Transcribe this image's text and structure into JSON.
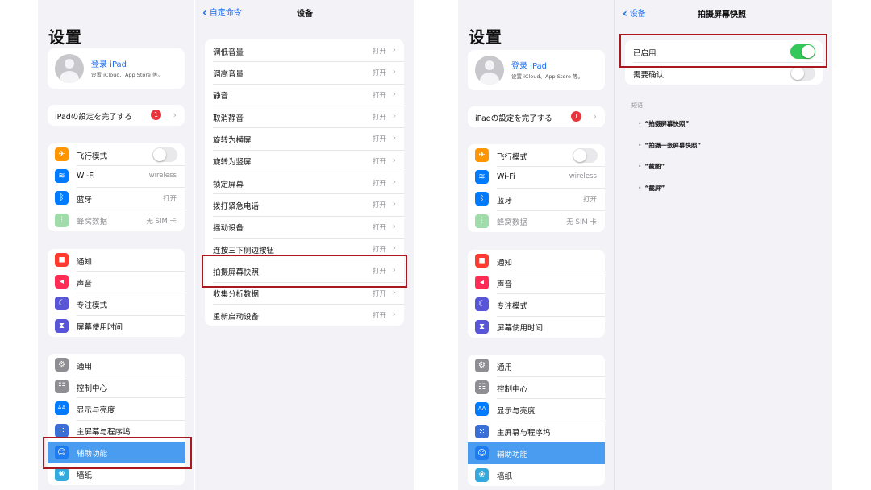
{
  "colors": {
    "accent": "#1b6ff2",
    "highlight": "#a9181f",
    "toggle_on": "#34c759",
    "selected_row": "#4a9cf0"
  },
  "left_screen": {
    "sidebar": {
      "title": "设置",
      "profile": {
        "name": "登录 iPad",
        "subtitle": "设置 iCloud、App Store 等。"
      },
      "setup": {
        "label": "iPadの設定を完了する",
        "badge": "1"
      },
      "group1": [
        {
          "label": "飞行模式",
          "icon": "airplane-icon",
          "color": "#ff9500",
          "glyph": "✈",
          "toggle": false
        },
        {
          "label": "Wi-Fi",
          "icon": "wifi-icon",
          "color": "#007aff",
          "glyph": "≋",
          "value": "wireless"
        },
        {
          "label": "蓝牙",
          "icon": "bluetooth-icon",
          "color": "#007aff",
          "glyph": "ᛒ",
          "value": "打开"
        },
        {
          "label": "蜂窝数据",
          "icon": "cellular-icon",
          "color": "#9fdca9",
          "glyph": "⫶",
          "value": "无 SIM 卡",
          "dim": true
        }
      ],
      "group2": [
        {
          "label": "通知",
          "icon": "notification-icon",
          "color": "#ff3b30",
          "glyph": "◼"
        },
        {
          "label": "声音",
          "icon": "sound-icon",
          "color": "#ff2d55",
          "glyph": "◂"
        },
        {
          "label": "专注模式",
          "icon": "moon-icon",
          "color": "#5856d6",
          "glyph": "☾"
        },
        {
          "label": "屏幕使用时间",
          "icon": "hourglass-icon",
          "color": "#5856d6",
          "glyph": "⧗"
        }
      ],
      "group3": [
        {
          "label": "通用",
          "icon": "gear-icon",
          "color": "#8e8e93",
          "glyph": "⚙"
        },
        {
          "label": "控制中心",
          "icon": "control-center-icon",
          "color": "#8e8e93",
          "glyph": "☷"
        },
        {
          "label": "显示与亮度",
          "icon": "display-icon",
          "color": "#007aff",
          "glyph": "AA"
        },
        {
          "label": "主屏幕与程序坞",
          "icon": "home-screen-icon",
          "color": "#3a6fd8",
          "glyph": "⁙"
        },
        {
          "label": "辅助功能",
          "icon": "accessibility-icon",
          "color": "#1e7cf0",
          "glyph": "☺",
          "selected": true
        },
        {
          "label": "墙纸",
          "icon": "wallpaper-icon",
          "color": "#34aadc",
          "glyph": "❀"
        }
      ]
    },
    "detail": {
      "back_label": "自定命令",
      "title": "设备",
      "items": [
        {
          "label": "调低音量",
          "value": "打开"
        },
        {
          "label": "调高音量",
          "value": "打开"
        },
        {
          "label": "静音",
          "value": "打开"
        },
        {
          "label": "取消静音",
          "value": "打开"
        },
        {
          "label": "旋转为横屏",
          "value": "打开"
        },
        {
          "label": "旋转为竖屏",
          "value": "打开"
        },
        {
          "label": "锁定屏幕",
          "value": "打开"
        },
        {
          "label": "拨打紧急电话",
          "value": "打开"
        },
        {
          "label": "摇动设备",
          "value": "打开"
        },
        {
          "label": "连按三下侧边按钮",
          "value": "打开"
        },
        {
          "label": "拍摄屏幕快照",
          "value": "打开"
        },
        {
          "label": "收集分析数据",
          "value": "打开"
        },
        {
          "label": "重新启动设备",
          "value": "打开"
        }
      ]
    }
  },
  "right_screen": {
    "sidebar": {
      "title": "设置",
      "profile": {
        "name": "登录 iPad",
        "subtitle": "设置 iCloud、App Store 等。"
      },
      "setup": {
        "label": "iPadの設定を完了する",
        "badge": "1"
      },
      "group1": [
        {
          "label": "飞行模式",
          "icon": "airplane-icon",
          "color": "#ff9500",
          "glyph": "✈",
          "toggle": false
        },
        {
          "label": "Wi-Fi",
          "icon": "wifi-icon",
          "color": "#007aff",
          "glyph": "≋",
          "value": "wireless"
        },
        {
          "label": "蓝牙",
          "icon": "bluetooth-icon",
          "color": "#007aff",
          "glyph": "ᛒ",
          "value": "打开"
        },
        {
          "label": "蜂窝数据",
          "icon": "cellular-icon",
          "color": "#9fdca9",
          "glyph": "⫶",
          "value": "无 SIM 卡",
          "dim": true
        }
      ],
      "group2": [
        {
          "label": "通知",
          "icon": "notification-icon",
          "color": "#ff3b30",
          "glyph": "◼"
        },
        {
          "label": "声音",
          "icon": "sound-icon",
          "color": "#ff2d55",
          "glyph": "◂"
        },
        {
          "label": "专注模式",
          "icon": "moon-icon",
          "color": "#5856d6",
          "glyph": "☾"
        },
        {
          "label": "屏幕使用时间",
          "icon": "hourglass-icon",
          "color": "#5856d6",
          "glyph": "⧗"
        }
      ],
      "group3": [
        {
          "label": "通用",
          "icon": "gear-icon",
          "color": "#8e8e93",
          "glyph": "⚙"
        },
        {
          "label": "控制中心",
          "icon": "control-center-icon",
          "color": "#8e8e93",
          "glyph": "☷"
        },
        {
          "label": "显示与亮度",
          "icon": "display-icon",
          "color": "#007aff",
          "glyph": "AA"
        },
        {
          "label": "主屏幕与程序坞",
          "icon": "home-screen-icon",
          "color": "#3a6fd8",
          "glyph": "⁙"
        },
        {
          "label": "辅助功能",
          "icon": "accessibility-icon",
          "color": "#1e7cf0",
          "glyph": "☺",
          "selected": true
        },
        {
          "label": "墙纸",
          "icon": "wallpaper-icon",
          "color": "#34aadc",
          "glyph": "❀"
        }
      ]
    },
    "detail": {
      "back_label": "设备",
      "title": "拍摄屏幕快照",
      "enabled_label": "已启用",
      "enabled": true,
      "confirm_label": "需要确认",
      "confirm": false,
      "phrases_header": "短语",
      "phrases": [
        "“拍摄屏幕快照”",
        "“拍摄一张屏幕快照”",
        "“截图”",
        "“截屏”"
      ]
    }
  }
}
